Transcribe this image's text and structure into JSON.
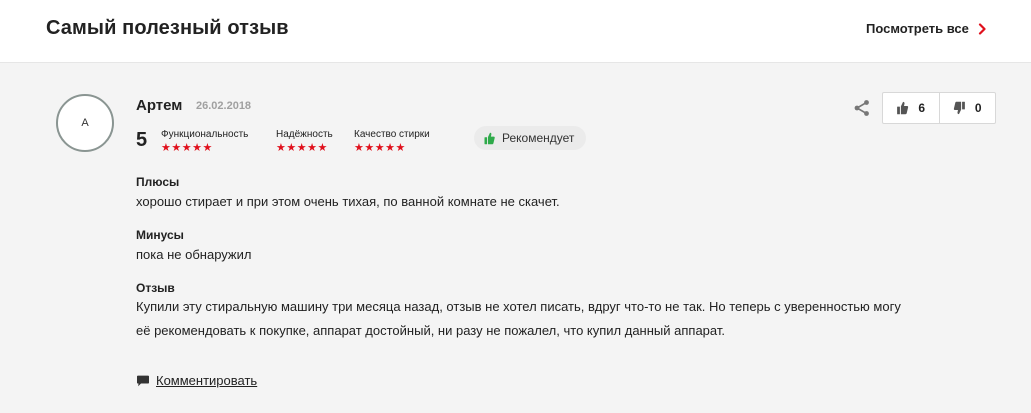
{
  "header": {
    "title": "Самый полезный отзыв",
    "see_all": "Посмотреть все"
  },
  "review": {
    "avatar_letter": "А",
    "author": "Артем",
    "date": "26.02.2018",
    "score": "5",
    "ratings": [
      {
        "label": "Функциональность",
        "stars": 5
      },
      {
        "label": "Надёжность",
        "stars": 5
      },
      {
        "label": "Качество стирки",
        "stars": 5
      }
    ],
    "recommend_label": "Рекомендует",
    "likes": "6",
    "dislikes": "0",
    "pros_title": "Плюсы",
    "pros_text": "хорошо стирает и при этом очень тихая, по ванной комнате не скачет.",
    "cons_title": "Минусы",
    "cons_text": "пока не обнаружил",
    "review_title": "Отзыв",
    "review_text": "Купили эту стиральную машину три месяца назад, отзыв не хотел писать, вдруг что-то не так. Но теперь с уверенностью могу её рекомендовать к покупке, аппарат достойный, ни разу не пожалел, что купил данный аппарат.",
    "comment_label": "Комментировать"
  },
  "colors": {
    "accent": "#e0101c",
    "recommend_green": "#2eaa4a",
    "card_bg": "#f4f4f4"
  }
}
